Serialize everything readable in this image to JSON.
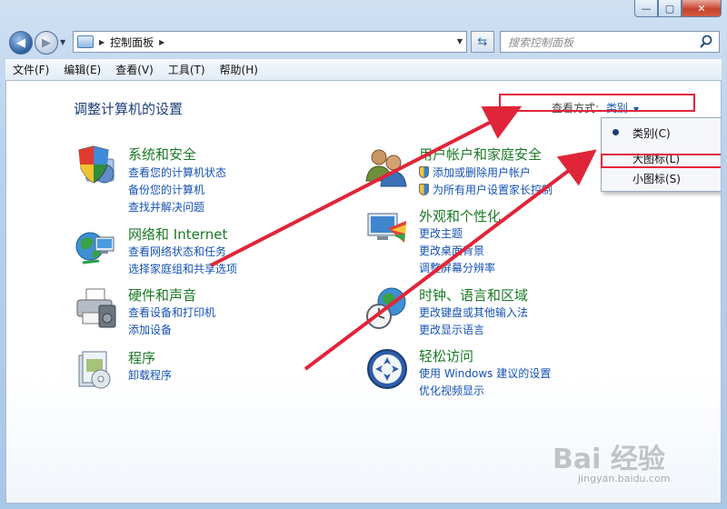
{
  "window": {
    "title": "",
    "controls": {
      "minimize": "—",
      "maximize": "▢",
      "close": "✕"
    }
  },
  "nav": {
    "back_icon": "back-arrow-icon",
    "forward_icon": "forward-arrow-icon",
    "address": "控制面板",
    "refresh_icon": "refresh-icon",
    "search_placeholder": "搜索控制面板"
  },
  "menu": [
    "文件(F)",
    "编辑(E)",
    "查看(V)",
    "工具(T)",
    "帮助(H)"
  ],
  "page": {
    "title": "调整计算机的设置",
    "view_label": "查看方式:",
    "view_value": "类别"
  },
  "categories": [
    {
      "title": "系统和安全",
      "icon": "shield-computer-icon",
      "links": [
        "查看您的计算机状态",
        "备份您的计算机",
        "查找并解决问题"
      ]
    },
    {
      "title": "网络和 Internet",
      "icon": "network-globe-icon",
      "links": [
        "查看网络状态和任务",
        "选择家庭组和共享选项"
      ]
    },
    {
      "title": "硬件和声音",
      "icon": "printer-icon",
      "links": [
        "查看设备和打印机",
        "添加设备"
      ]
    },
    {
      "title": "程序",
      "icon": "programs-icon",
      "links": [
        "卸载程序"
      ]
    },
    {
      "title": "用户帐户和家庭安全",
      "icon": "users-icon",
      "links": [
        "添加或删除用户帐户",
        "为所有用户设置家长控制"
      ]
    },
    {
      "title": "外观和个性化",
      "icon": "monitor-palette-icon",
      "links": [
        "更改主题",
        "更改桌面背景",
        "调整屏幕分辨率"
      ]
    },
    {
      "title": "时钟、语言和区域",
      "icon": "clock-globe-icon",
      "links": [
        "更改键盘或其他输入法",
        "更改显示语言"
      ]
    },
    {
      "title": "轻松访问",
      "icon": "ease-of-access-icon",
      "links": [
        "使用 Windows 建议的设置",
        "优化视频显示"
      ]
    }
  ],
  "dropdown": {
    "items": [
      "类别(C)",
      "大图标(L)",
      "小图标(S)"
    ],
    "selected_index": 0
  },
  "watermark": {
    "text": "Bai 经验",
    "url": "jingyan.baidu.com"
  },
  "colors": {
    "annotation": "#e0253a",
    "link": "#1552b5",
    "category_title": "#1b7a25"
  }
}
